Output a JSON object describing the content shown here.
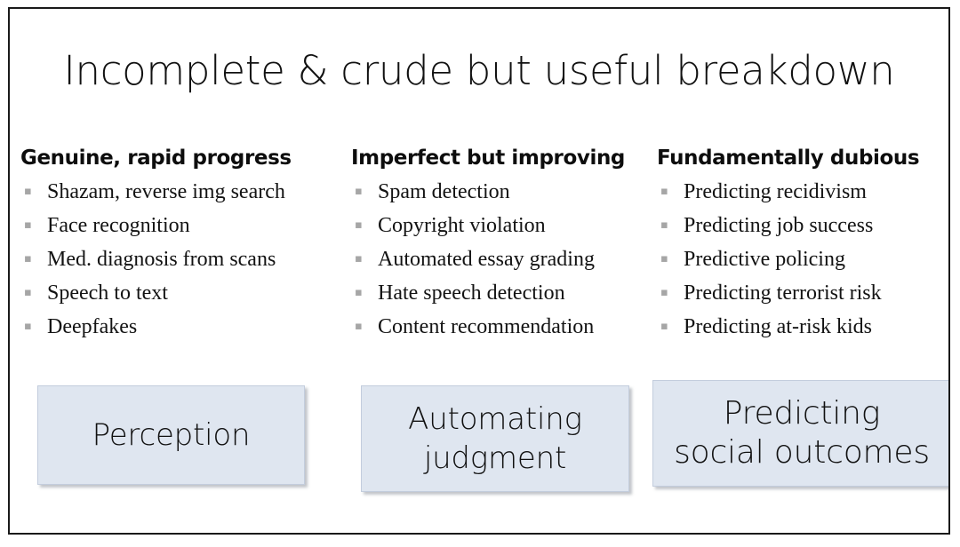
{
  "slide": {
    "title": "Incomplete & crude but useful breakdown",
    "bullet_glyph": "▪",
    "columns": [
      {
        "header": "Genuine, rapid progress",
        "items": [
          "Shazam, reverse img search",
          "Face recognition",
          "Med. diagnosis from scans",
          "Speech to text",
          "Deepfakes"
        ]
      },
      {
        "header": "Imperfect but improving",
        "items": [
          "Spam detection",
          "Copyright violation",
          "Automated essay grading",
          "Hate speech detection",
          "Content recommendation"
        ]
      },
      {
        "header": "Fundamentally dubious",
        "items": [
          "Predicting recidivism",
          "Predicting job success",
          "Predictive policing",
          "Predicting terrorist risk",
          "Predicting at-risk kids"
        ]
      }
    ],
    "category_boxes": [
      {
        "line1": "Perception",
        "line2": ""
      },
      {
        "line1": "Automating",
        "line2": "judgment"
      },
      {
        "line1": "Predicting",
        "line2": "social outcomes"
      }
    ],
    "colors": {
      "box_fill": "#dfe6f0",
      "box_border": "#c3cddd",
      "slide_border": "#1a1a1a",
      "bullet_gray": "#a6a6a6",
      "text": "#111111"
    }
  }
}
